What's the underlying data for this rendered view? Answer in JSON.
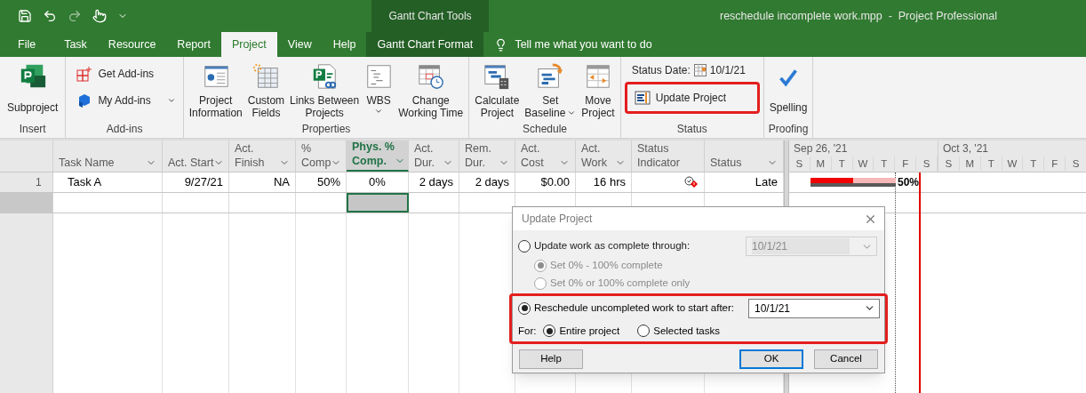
{
  "title_bar": {
    "context_label": "Gantt Chart Tools",
    "title": "reschedule incomplete work.mpp  -  Project Professional"
  },
  "tabs": [
    {
      "label": "File",
      "kind": "file",
      "selected": false
    },
    {
      "label": "Task",
      "kind": "normal",
      "selected": false
    },
    {
      "label": "Resource",
      "kind": "normal",
      "selected": false
    },
    {
      "label": "Report",
      "kind": "normal",
      "selected": false
    },
    {
      "label": "Project",
      "kind": "normal",
      "selected": true
    },
    {
      "label": "View",
      "kind": "normal",
      "selected": false
    },
    {
      "label": "Help",
      "kind": "normal",
      "selected": false
    },
    {
      "label": "Gantt Chart Format",
      "kind": "contextual",
      "selected": false
    }
  ],
  "tell_me": {
    "placeholder": "Tell me what you want to do"
  },
  "ribbon_groups": [
    {
      "label": "Insert",
      "buttons": [
        {
          "kind": "large",
          "lines": [
            "Subproject"
          ]
        }
      ]
    },
    {
      "label": "Add-ins",
      "buttons": [
        {
          "kind": "small",
          "lines": [
            "Get Add-ins"
          ]
        },
        {
          "kind": "small",
          "lines": [
            "My Add-ins"
          ],
          "dropdown": true
        }
      ]
    },
    {
      "label": "Properties",
      "buttons": [
        {
          "kind": "large",
          "lines": [
            "Project",
            "Information"
          ]
        },
        {
          "kind": "large",
          "lines": [
            "Custom",
            "Fields"
          ]
        },
        {
          "kind": "large",
          "lines": [
            "Links Between",
            "Projects"
          ]
        },
        {
          "kind": "large",
          "lines": [
            "WBS"
          ],
          "dropdown": true
        },
        {
          "kind": "large",
          "lines": [
            "Change",
            "Working Time"
          ]
        }
      ]
    },
    {
      "label": "Schedule",
      "buttons": [
        {
          "kind": "large",
          "lines": [
            "Calculate",
            "Project"
          ]
        },
        {
          "kind": "large",
          "lines": [
            "Set",
            "Baseline"
          ],
          "dropdown": true
        },
        {
          "kind": "large",
          "lines": [
            "Move",
            "Project"
          ]
        }
      ]
    },
    {
      "label": "Status",
      "buttons": [
        {
          "kind": "status_date",
          "lines": [
            "Status Date:",
            "10/1/21"
          ]
        },
        {
          "kind": "small",
          "lines": [
            "Update Project"
          ],
          "highlighted": true
        }
      ]
    },
    {
      "label": "Proofing",
      "buttons": [
        {
          "kind": "large",
          "lines": [
            "Spelling"
          ]
        }
      ]
    }
  ],
  "table": {
    "columns": [
      {
        "lines": [
          "Task Name"
        ],
        "kind": "name",
        "filter": true,
        "selected": false
      },
      {
        "lines": [
          "Act. Start"
        ],
        "kind": "number",
        "filter": true,
        "selected": false
      },
      {
        "lines": [
          "Act.",
          "Finish"
        ],
        "kind": "number",
        "filter": true,
        "selected": false
      },
      {
        "lines": [
          "%",
          "Comp"
        ],
        "kind": "number",
        "filter": true,
        "selected": false
      },
      {
        "lines": [
          "Phys. %",
          "Comp."
        ],
        "kind": "centered",
        "filter": true,
        "selected": true
      },
      {
        "lines": [
          "Act.",
          "Dur."
        ],
        "kind": "number",
        "filter": true,
        "selected": false
      },
      {
        "lines": [
          "Rem.",
          "Dur."
        ],
        "kind": "number",
        "filter": true,
        "selected": false
      },
      {
        "lines": [
          "Act.",
          "Cost"
        ],
        "kind": "number",
        "filter": true,
        "selected": false
      },
      {
        "lines": [
          "Act.",
          "Work"
        ],
        "kind": "number",
        "filter": true,
        "selected": false
      },
      {
        "lines": [
          "Status",
          "Indicator"
        ],
        "kind": "indicator",
        "selected": false
      },
      {
        "lines": [
          "Status"
        ],
        "kind": "number",
        "filter": true,
        "selected": false
      }
    ],
    "rows": [
      {
        "id": "1",
        "cells": [
          "Task A",
          "9/27/21",
          "NA",
          "50%",
          "0%",
          "2 days",
          "2 days",
          "$0.00",
          "16 hrs",
          "Late"
        ],
        "late_indicator": true
      }
    ],
    "new_row": {
      "selected": true
    }
  },
  "gantt": {
    "weeks": [
      {
        "label": "Sep 26, '21",
        "days": [
          "S",
          "M",
          "T",
          "W",
          "T",
          "F",
          "S"
        ]
      },
      {
        "label": "Oct 3, '21",
        "days": [
          "S",
          "M",
          "T",
          "W",
          "T",
          "F",
          "S"
        ]
      }
    ],
    "task_bar": {
      "level": 0.5,
      "label": "50%"
    }
  },
  "dialog": {
    "title": "Update Project",
    "update_option": {
      "label": "Update work as complete through:",
      "selected": false,
      "date": "10/1/21",
      "disabled": true
    },
    "sub_options": [
      {
        "label": "Set 0% - 100% complete",
        "selected": true,
        "disabled": true
      },
      {
        "label": "Set 0% or 100% complete only",
        "selected": false,
        "disabled": true
      }
    ],
    "reschedule_option": {
      "label": "Reschedule uncompleted work to start after:",
      "selected": true,
      "date": "10/1/21",
      "highlighted": true
    },
    "for_label": "For:",
    "scope_options": [
      {
        "label": "Entire project",
        "selected": true
      },
      {
        "label": "Selected tasks",
        "selected": false
      }
    ],
    "buttons": [
      {
        "label": "Help",
        "default": false
      },
      {
        "label": "OK",
        "default": true
      },
      {
        "label": "Cancel",
        "default": false
      }
    ]
  }
}
